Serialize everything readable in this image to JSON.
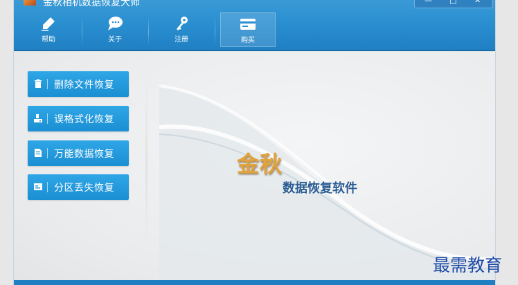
{
  "window": {
    "title": "金秋相机数据恢复大师",
    "controls": {
      "minimize": "—",
      "maximize": "□",
      "close": "✕"
    }
  },
  "toolbar": {
    "items": [
      {
        "label": "帮助",
        "icon": "pen-icon"
      },
      {
        "label": "关于",
        "icon": "chat-bubble-icon"
      },
      {
        "label": "注册",
        "icon": "key-icon"
      },
      {
        "label": "购买",
        "icon": "card-icon"
      }
    ]
  },
  "menu": {
    "items": [
      {
        "label": "删除文件恢复",
        "icon": "trash-icon"
      },
      {
        "label": "误格式化恢复",
        "icon": "drive-icon"
      },
      {
        "label": "万能数据恢复",
        "icon": "document-icon"
      },
      {
        "label": "分区丢失恢复",
        "icon": "partition-icon"
      }
    ]
  },
  "branding": {
    "name": "金秋",
    "tagline": "数据恢复软件"
  },
  "watermark": "最需教育",
  "colors": {
    "titlebar": "#2a8fd0",
    "button": "#1f95d8",
    "brand_gold": "#e1a33a",
    "brand_blue": "#2d5e93"
  }
}
